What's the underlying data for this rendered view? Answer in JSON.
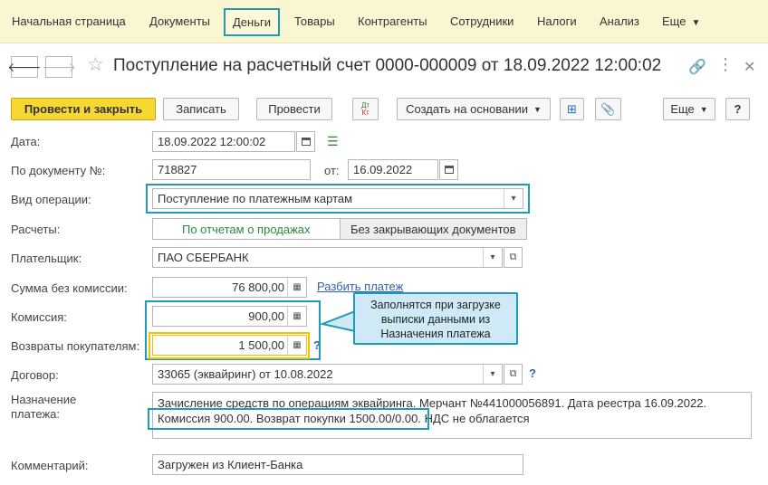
{
  "menu": {
    "items": [
      "Начальная страница",
      "Документы",
      "Деньги",
      "Товары",
      "Контрагенты",
      "Сотрудники",
      "Налоги",
      "Анализ",
      "Еще"
    ],
    "active": "Деньги"
  },
  "header": {
    "title": "Поступление на расчетный счет 0000-000009 от 18.09.2022 12:00:02"
  },
  "toolbar": {
    "post_close": "Провести и закрыть",
    "save": "Записать",
    "post": "Провести",
    "dt_kt": "Дт Кт",
    "create_based": "Создать на основании",
    "more": "Еще",
    "help": "?"
  },
  "form": {
    "date_label": "Дата:",
    "date_value": "18.09.2022 12:00:02",
    "doc_no_label": "По документу №:",
    "doc_no_value": "718827",
    "from_label": "от:",
    "from_value": "16.09.2022",
    "op_label": "Вид операции:",
    "op_value": "Поступление по платежным картам",
    "calc_label": "Расчеты:",
    "calc_option1": "По отчетам о продажах",
    "calc_option2": "Без закрывающих документов",
    "payer_label": "Плательщик:",
    "payer_value": "ПАО СБЕРБАНК",
    "sum_label": "Сумма без комиссии:",
    "sum_value": "76 800,00",
    "split_link": "Разбить платеж",
    "commission_label": "Комиссия:",
    "commission_value": "900,00",
    "returns_label": "Возвраты покупателям:",
    "returns_value": "1 500,00",
    "contract_label": "Договор:",
    "contract_value": "33065 (эквайринг) от 10.08.2022",
    "purpose_label_1": "Назначение",
    "purpose_label_2": "платежа:",
    "purpose_line1": "Зачисление средств по операциям эквайринга. Мерчант №441000056891. Дата реестра 16.09.2022.",
    "purpose_line2": "Комиссия 900.00. Возврат покупки 1500.00/0.00. НДС не облагается",
    "comment_label": "Комментарий:",
    "comment_value": "Загружен из Клиент-Банка"
  },
  "callout": {
    "text_1": "Заполнятся при загрузке",
    "text_2": "выписки данными из",
    "text_3": "Назначения платежа"
  }
}
